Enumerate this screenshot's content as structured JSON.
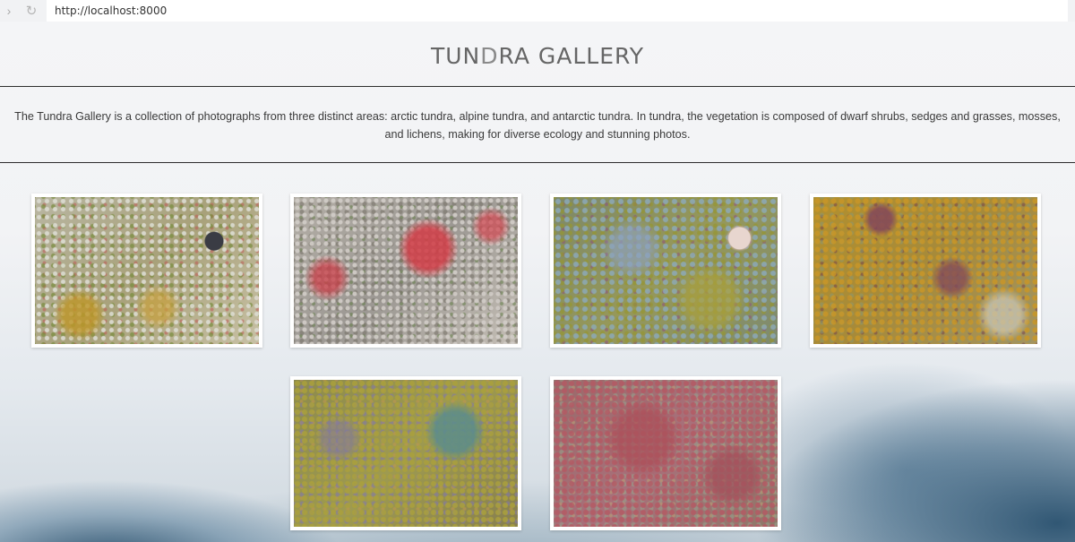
{
  "browser": {
    "url": "http://localhost:8000",
    "forward_icon": "chevron-right-icon",
    "reload_icon": "reload-icon"
  },
  "header": {
    "title_pre": "TUN",
    "title_hl": "D",
    "title_post": "RA GALLERY"
  },
  "description": "The Tundra Gallery is a collection of photographs from three distinct areas: arctic tundra, alpine tundra, and antarctic tundra. In tundra, the vegetation is composed of dwarf shrubs, sedges and grasses, mosses, and lichens, making for diverse ecology and stunning photos.",
  "gallery": {
    "photos": [
      {
        "subject": "lichen and moss with dark rock"
      },
      {
        "subject": "red leaves on gravel"
      },
      {
        "subject": "moss with mushroom"
      },
      {
        "subject": "golden moss and purple leaves"
      },
      {
        "subject": "moss and blue-green shrub"
      },
      {
        "subject": "red moss ground cover"
      }
    ]
  }
}
